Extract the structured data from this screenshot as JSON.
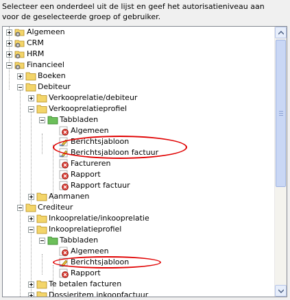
{
  "instruction": "Selecteer een onderdeel uit de lijst en geef het autorisatieniveau aan voor de geselecteerde groep of gebruiker.",
  "tree": {
    "algemeen": "Algemeen",
    "crm": "CRM",
    "hrm": "HRM",
    "financieel": "Financieel",
    "boeken": "Boeken",
    "debiteur": "Debiteur",
    "verkooprelatie_debiteur": "Verkooprelatie/debiteur",
    "verkooprelatieprofiel": "Verkooprelatieprofiel",
    "tabbladen_1": "Tabbladen",
    "d_algemeen": "Algemeen",
    "d_berichtsjabloon": "Berichtsjabloon",
    "d_berichtsjabloon_factuur": "Berichtsjabloon factuur",
    "d_factureren": "Factureren",
    "d_rapport": "Rapport",
    "d_rapport_factuur": "Rapport factuur",
    "aanmanen": "Aanmanen",
    "crediteur": "Crediteur",
    "inkooprelatie_inkooprelatie": "Inkooprelatie/inkooprelatie",
    "inkooprelatieprofiel": "Inkooprelatieprofiel",
    "tabbladen_2": "Tabbladen",
    "c_algemeen": "Algemeen",
    "c_berichtsjabloon": "Berichtsjabloon",
    "c_rapport": "Rapport",
    "te_betalen_facturen": "Te betalen facturen",
    "dossieritem_inkoopfactuur": "Dossieritem inkoopfactuur"
  },
  "colors": {
    "highlight": "#e00000",
    "folder": "#f3d56a",
    "tab_folder": "#6cbf5a",
    "denied": "#d9342b",
    "partial": "#e8c23c"
  },
  "icons": {
    "group_folder": "folder-gear-icon",
    "folder": "folder-icon",
    "tab_folder": "green-folder-icon",
    "denied": "no-access-icon",
    "partial": "partial-access-icon"
  }
}
